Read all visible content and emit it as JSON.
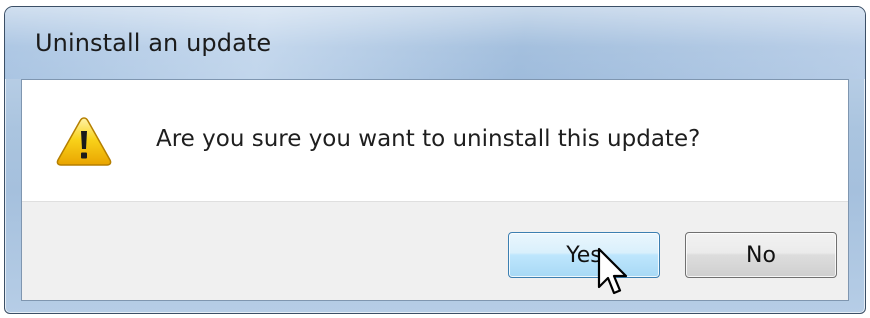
{
  "window": {
    "title": "Uninstall an update"
  },
  "dialog": {
    "icon": "warning-icon",
    "message": "Are you sure you want to uninstall this update?"
  },
  "buttons": {
    "yes_label": "Yes",
    "no_label": "No"
  },
  "colors": {
    "title_bar": "#a9c4e2",
    "warning_yellow": "#f6c500",
    "yes_button_hover": "#bee6fd",
    "yes_button_border": "#3c7fb1",
    "no_button_border": "#707070"
  }
}
